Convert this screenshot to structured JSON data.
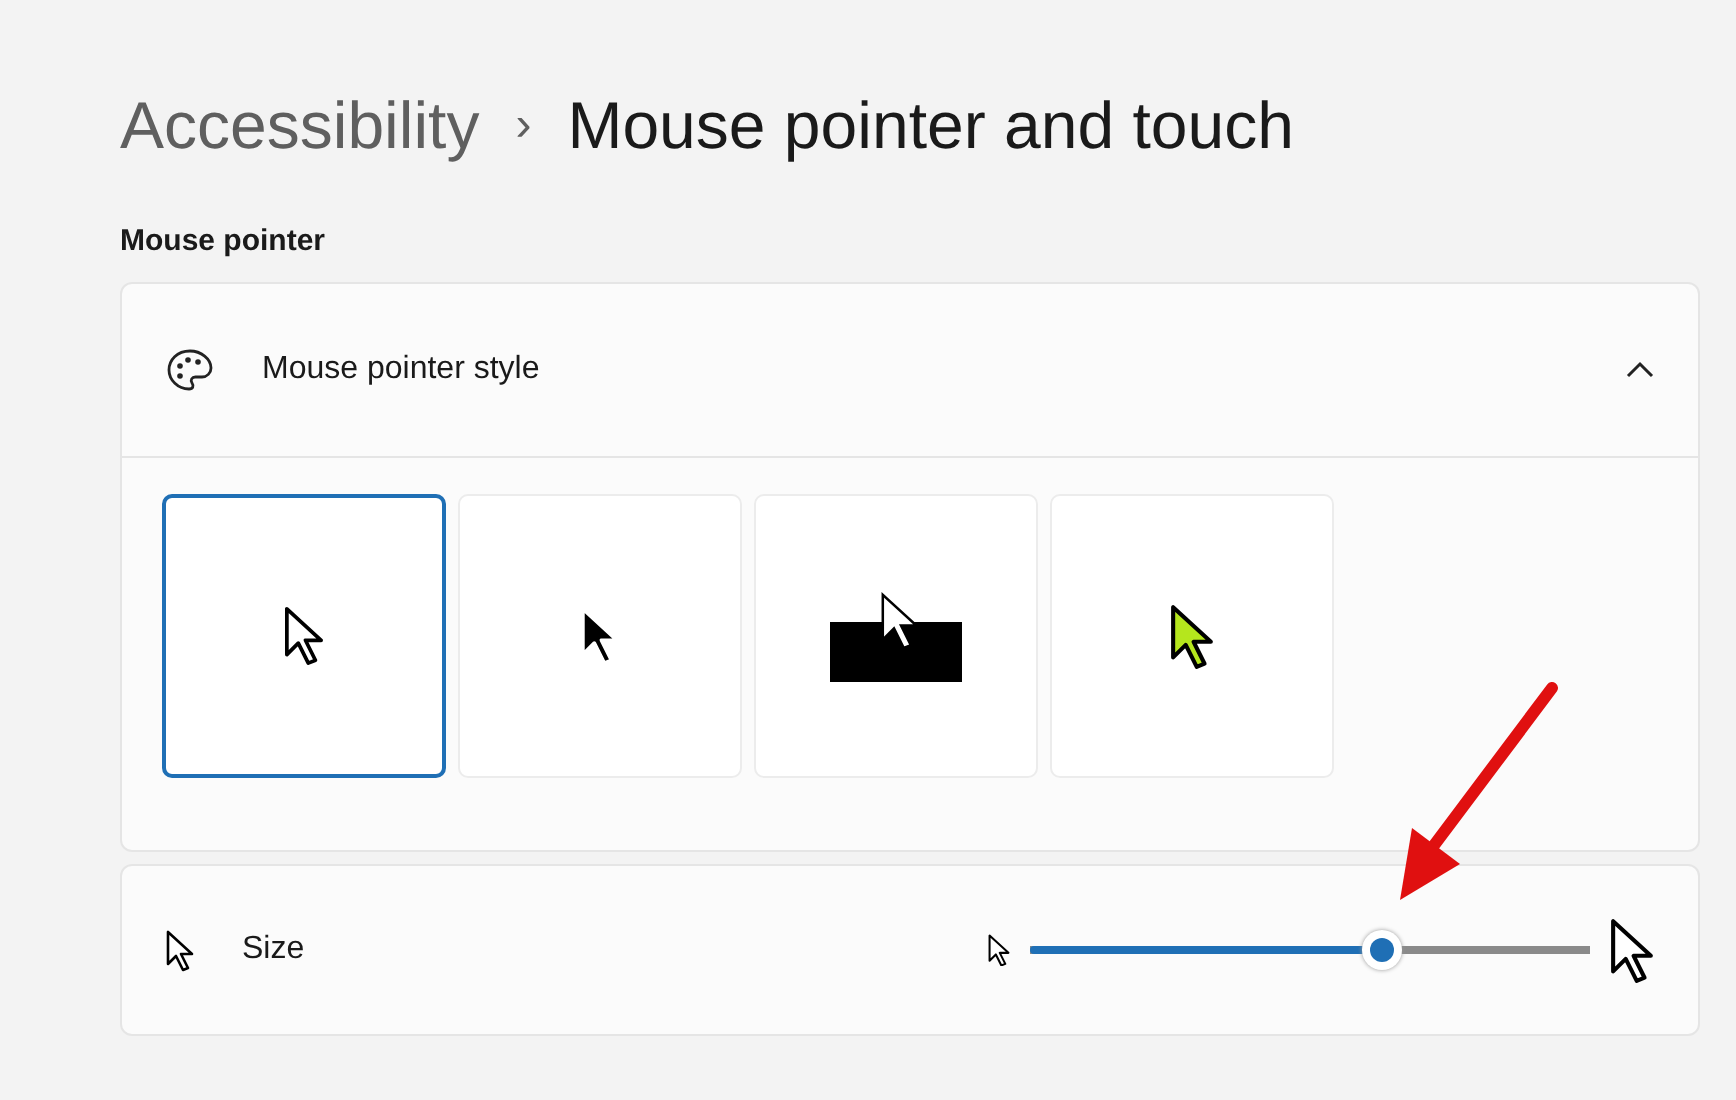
{
  "breadcrumb": {
    "parent": "Accessibility",
    "separator": "›",
    "current": "Mouse pointer and touch"
  },
  "section_label": "Mouse pointer",
  "pointer_style": {
    "label": "Mouse pointer style",
    "expanded": true,
    "styles": [
      {
        "kind": "white",
        "selected": true
      },
      {
        "kind": "black",
        "selected": false
      },
      {
        "kind": "inverted",
        "selected": false
      },
      {
        "kind": "custom",
        "selected": false,
        "color": "#b5e61d"
      }
    ]
  },
  "size": {
    "label": "Size",
    "level": 0.63
  }
}
